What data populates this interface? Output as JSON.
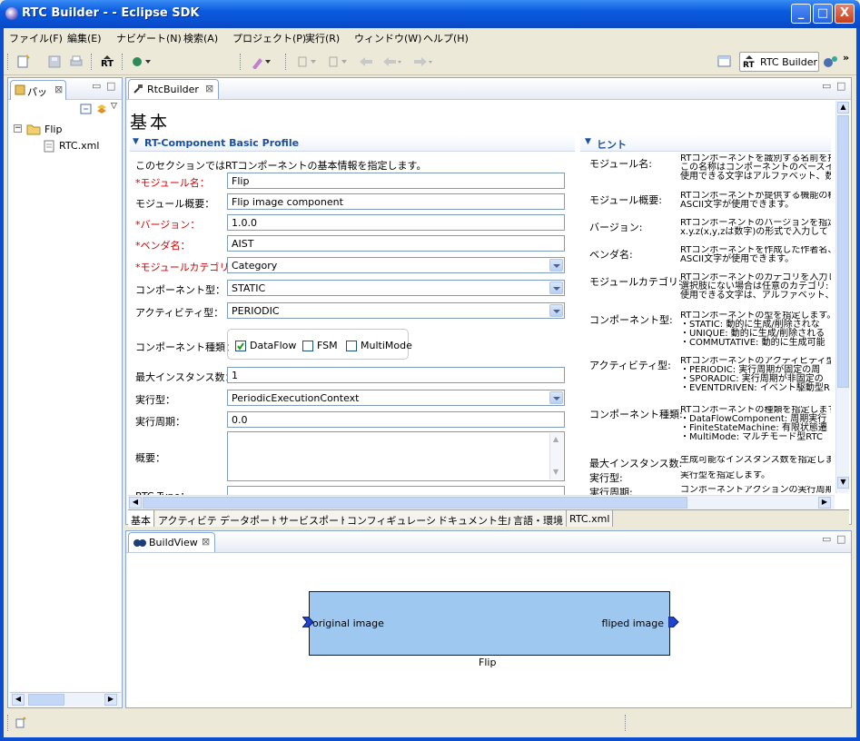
{
  "window": {
    "title": "RTC Builder -  - Eclipse SDK",
    "minimize": "_",
    "maximize": "□",
    "close": "X"
  },
  "menu": [
    "ファイル(F)",
    "編集(E)",
    "ナビゲート(N)",
    "検索(A)",
    "プロジェクト(P)",
    "実行(R)",
    "ウィンドウ(W)",
    "ヘルプ(H)"
  ],
  "toolbar": {
    "perspective_label": "RTC Builder",
    "overflow": "»"
  },
  "left_pane": {
    "tab": "パッ",
    "tree_root": "Flip",
    "tree_child": "RTC.xml"
  },
  "editor": {
    "tab": "RtcBuilder",
    "page_title": "基本",
    "section_title": "RT-Component Basic Profile",
    "section_desc": "このセクションではRTコンポーネントの基本情報を指定します。",
    "fields": {
      "module_name_label": "*モジュール名：",
      "module_name": "Flip",
      "module_desc_label": "モジュール概要：",
      "module_desc": "Flip image component",
      "version_label": "*バージョン：",
      "version": "1.0.0",
      "vendor_label": "*ベンダ名：",
      "vendor": "AIST",
      "category_label": "*モジュールカテゴリ：",
      "category": "Category",
      "comp_type_label": "コンポーネント型：",
      "comp_type": "STATIC",
      "activity_type_label": "アクティビティ型：",
      "activity_type": "PERIODIC",
      "comp_kind_label": "コンポーネント種類：",
      "kind_dataflow": "DataFlow",
      "kind_fsm": "FSM",
      "kind_multimode": "MultiMode",
      "max_inst_label": "最大インスタンス数：",
      "max_inst": "1",
      "exec_type_label": "実行型：",
      "exec_type": "PeriodicExecutionContext",
      "exec_rate_label": "実行周期：",
      "exec_rate": "0.0",
      "summary_label": "概要：",
      "rtc_type_label": "RTC Type："
    },
    "hint_title": "ヒント",
    "hints": [
      {
        "label": "モジュール名:",
        "lines": [
          "RTコンポーネントを識別する名前を指",
          "この名称はコンポーネントのベースイン",
          "使用できる文字はアルファベット、数字"
        ]
      },
      {
        "label": "モジュール概要:",
        "lines": [
          "RTコンポーネントが提供する機能の概",
          "ASCII文字が使用できます。"
        ]
      },
      {
        "label": "バージョン:",
        "lines": [
          "RTコンポーネントのバージョンを指定し",
          "x.y.z(x,y,zは数字)の形式で入力して"
        ]
      },
      {
        "label": "ベンダ名:",
        "lines": [
          "RTコンポーネントを作成した作者名、",
          "ASCII文字が使用できます。"
        ]
      },
      {
        "label": "モジュールカテゴリ:",
        "lines": [
          "RTコンポーネントのカテゴリを入力しま",
          "選択肢にない場合は任意のカテゴリ:",
          "使用できる文字は、アルファベット、数"
        ]
      },
      {
        "label": "コンポーネント型:",
        "lines": [
          "RTコンポーネントの型を指定します。",
          "・STATIC: 動的に生成/削除されな",
          "・UNIQUE: 動的に生成/削除される",
          "・COMMUTATIVE: 動的に生成可能"
        ]
      },
      {
        "label": "アクティビティ型:",
        "lines": [
          "RTコンポーネントのアクティビティ型を:",
          "・PERIODIC: 実行周期が固定の周",
          "・SPORADIC: 実行周期が非固定の",
          "・EVENTDRIVEN: イベント駆動型R"
        ]
      },
      {
        "label": "コンポーネント種類:",
        "lines": [
          "RTコンポーネントの種類を指定します",
          "・DataFlowComponent: 周期実行",
          "・FiniteStateMachine: 有限状態遷",
          "・MultiMode: マルチモード型RTC"
        ]
      },
      {
        "label": "最大インスタンス数:",
        "lines": [
          "生成可能なインスタンス数を指定しま"
        ]
      },
      {
        "label": "実行型:",
        "lines": [
          "実行型を指定します。"
        ]
      },
      {
        "label": "実行周期:",
        "lines": [
          "コンポーネントアクションの実行周期を"
        ]
      }
    ],
    "bottom_tabs": [
      "基本",
      "アクティビティ",
      "データポート",
      "サービスポート",
      "コンフィギュレーション",
      "ドキュメント生成",
      "言語・環境",
      "RTC.xml"
    ]
  },
  "buildview": {
    "tab": "BuildView",
    "component_name": "Flip",
    "in_port": "original image",
    "out_port": "fliped image"
  }
}
